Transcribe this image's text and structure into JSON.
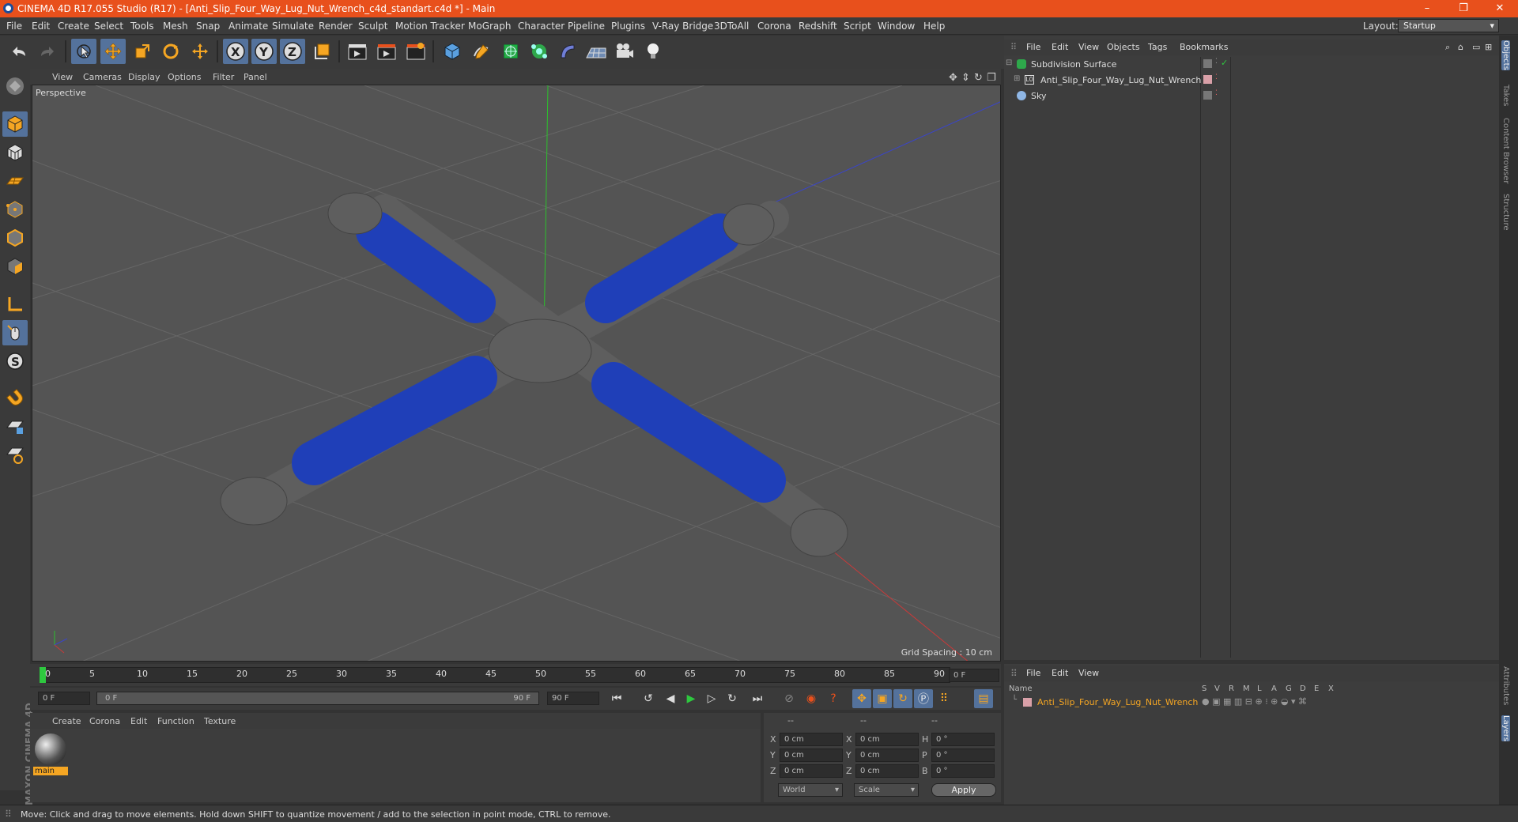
{
  "titlebar": {
    "title": "CINEMA 4D R17.055 Studio (R17) - [Anti_Slip_Four_Way_Lug_Nut_Wrench_c4d_standart.c4d *] - Main"
  },
  "menu": {
    "items": [
      "File",
      "Edit",
      "Create",
      "Select",
      "Tools",
      "Mesh",
      "Snap",
      "Animate",
      "Simulate",
      "Render",
      "Sculpt",
      "Motion Tracker",
      "MoGraph",
      "Character",
      "Pipeline",
      "Plugins",
      "V-Ray Bridge",
      "3DToAll",
      "Corona",
      "Redshift",
      "Script",
      "Window",
      "Help"
    ],
    "layout_label": "Layout:",
    "layout_value": "Startup"
  },
  "viewport": {
    "menu": [
      "View",
      "Cameras",
      "Display",
      "Options",
      "Filter",
      "Panel"
    ],
    "label": "Perspective",
    "grid_spacing": "Grid Spacing : 10 cm"
  },
  "timeline": {
    "ticks": [
      "0",
      "5",
      "10",
      "15",
      "20",
      "25",
      "30",
      "35",
      "40",
      "45",
      "50",
      "55",
      "60",
      "65",
      "70",
      "75",
      "80",
      "85",
      "90"
    ],
    "current_frame": "0 F",
    "start_field": "0 F",
    "range_start": "0 F",
    "range_end": "90 F",
    "end_field": "90 F"
  },
  "material": {
    "menu": [
      "Create",
      "Corona",
      "Edit",
      "Function",
      "Texture"
    ],
    "name": "main"
  },
  "coords": {
    "headers": [
      "--",
      "--",
      "--"
    ],
    "rows": [
      {
        "a": "X",
        "av": "0 cm",
        "b": "X",
        "bv": "0 cm",
        "c": "H",
        "cv": "0 °"
      },
      {
        "a": "Y",
        "av": "0 cm",
        "b": "Y",
        "bv": "0 cm",
        "c": "P",
        "cv": "0 °"
      },
      {
        "a": "Z",
        "av": "0 cm",
        "b": "Z",
        "bv": "0 cm",
        "c": "B",
        "cv": "0 °"
      }
    ],
    "world": "World",
    "scale": "Scale",
    "apply": "Apply"
  },
  "objects": {
    "menu": [
      "File",
      "Edit",
      "View",
      "Objects",
      "Tags",
      "Bookmarks"
    ],
    "items": [
      {
        "name": "Subdivision Surface",
        "indent": 0
      },
      {
        "name": "Anti_Slip_Four_Way_Lug_Nut_Wrench",
        "indent": 1
      },
      {
        "name": "Sky",
        "indent": 0
      }
    ]
  },
  "layers": {
    "menu": [
      "File",
      "Edit",
      "View"
    ],
    "columns": [
      "Name",
      "S",
      "V",
      "R",
      "M",
      "L",
      "A",
      "G",
      "D",
      "E",
      "X"
    ],
    "row": "Anti_Slip_Four_Way_Lug_Nut_Wrench"
  },
  "rightTabs": [
    "Objects",
    "Takes",
    "Content Browser",
    "Structure",
    "Attributes",
    "Layers"
  ],
  "status": "Move: Click and drag to move elements. Hold down SHIFT to quantize movement / add to the selection in point mode, CTRL to remove.",
  "maxon": "MAXON CINEMA 4D",
  "colors": {
    "accent": "#e8501c",
    "selected": "#54729c",
    "grip": "#1f3fb8",
    "metal": "#5d5d5d"
  }
}
